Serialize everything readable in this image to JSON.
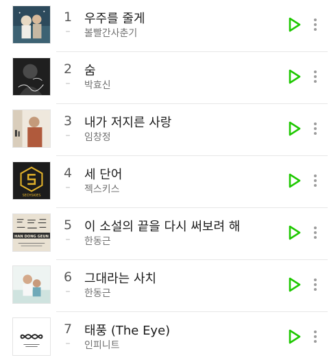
{
  "accent_color": "#1ec800",
  "tracks": [
    {
      "rank": "1",
      "title": "우주를 줄게",
      "change": "–",
      "artist": "볼빨간사춘기",
      "cover_text": ""
    },
    {
      "rank": "2",
      "title": "숨",
      "change": "–",
      "artist": "박효신",
      "cover_text": ""
    },
    {
      "rank": "3",
      "title": "내가 저지른 사랑",
      "change": "–",
      "artist": "임창정",
      "cover_text": ""
    },
    {
      "rank": "4",
      "title": "세 단어",
      "change": "–",
      "artist": "젝스키스",
      "cover_text": "SECHSKIES"
    },
    {
      "rank": "5",
      "title": "이 소설의 끝을 다시 써보려 해",
      "change": "–",
      "artist": "한동근",
      "cover_text": "HAN DONG GEUN"
    },
    {
      "rank": "6",
      "title": "그대라는 사치",
      "change": "–",
      "artist": "한동근",
      "cover_text": ""
    },
    {
      "rank": "7",
      "title": "태풍 (The Eye)",
      "change": "–",
      "artist": "인피니트",
      "cover_text": ""
    }
  ],
  "icons": {
    "play": "play-icon",
    "more": "more-vertical-icon"
  }
}
